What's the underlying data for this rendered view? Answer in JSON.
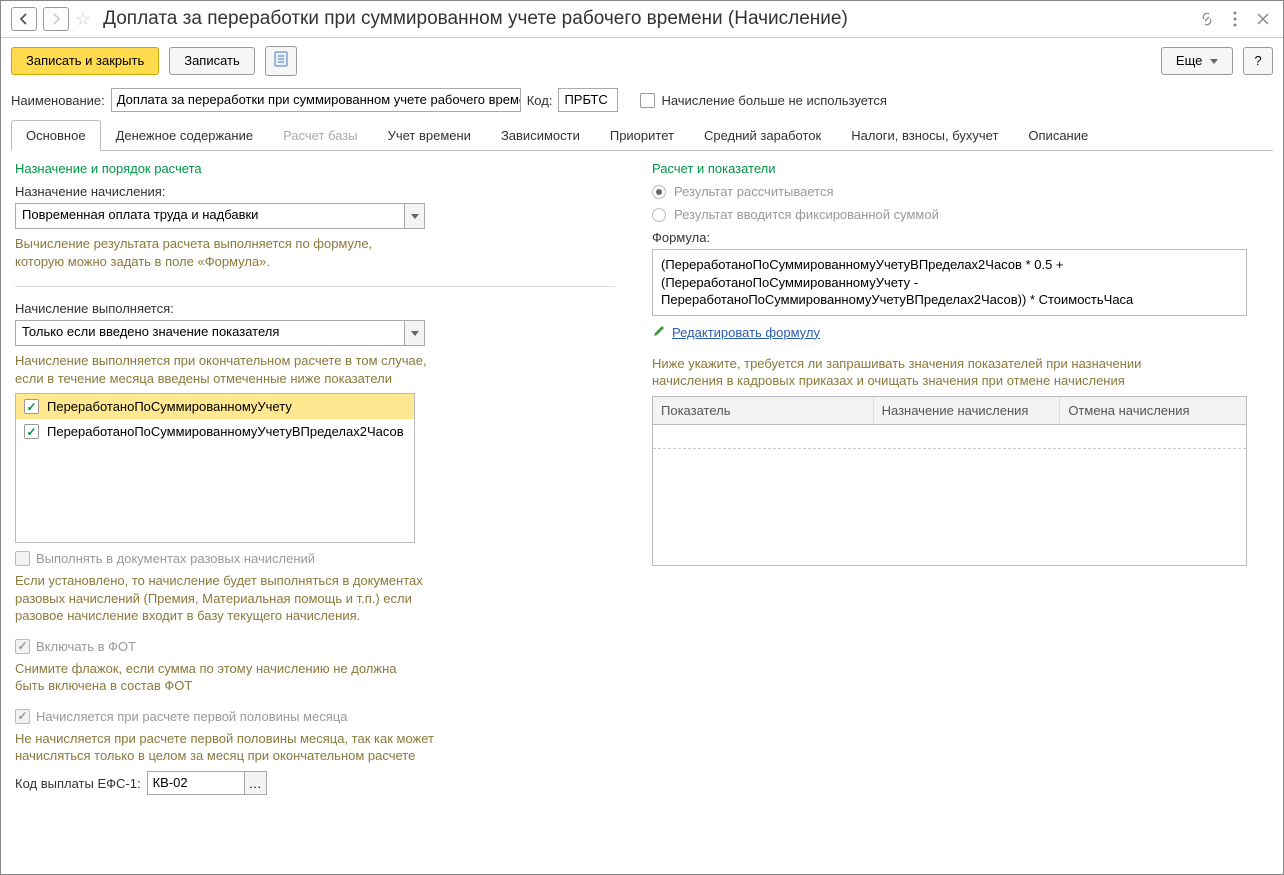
{
  "titlebar": {
    "title": "Доплата за переработки при суммированном учете рабочего времени (Начисление)"
  },
  "toolbar": {
    "save_close": "Записать и закрыть",
    "save": "Записать",
    "more": "Еще",
    "help": "?"
  },
  "header_fields": {
    "name_label": "Наименование:",
    "name_value": "Доплата за переработки при суммированном учете рабочего време",
    "code_label": "Код:",
    "code_value": "ПРБТС",
    "not_used_label": "Начисление больше не используется"
  },
  "tabs": [
    {
      "label": "Основное",
      "active": true
    },
    {
      "label": "Денежное содержание"
    },
    {
      "label": "Расчет базы",
      "disabled": true
    },
    {
      "label": "Учет времени"
    },
    {
      "label": "Зависимости"
    },
    {
      "label": "Приоритет"
    },
    {
      "label": "Средний заработок"
    },
    {
      "label": "Налоги, взносы, бухучет"
    },
    {
      "label": "Описание"
    }
  ],
  "left": {
    "section1_title": "Назначение и порядок расчета",
    "purpose_label": "Назначение начисления:",
    "purpose_value": "Повременная оплата труда и надбавки",
    "purpose_hint": "Вычисление результата расчета выполняется по формуле, которую можно задать в поле «Формула».",
    "exec_label": "Начисление выполняется:",
    "exec_value": "Только если введено значение показателя",
    "exec_hint": "Начисление выполняется при окончательном расчете в том случае, если в течение месяца введены отмеченные ниже показатели",
    "indicators": [
      {
        "label": "ПереработаноПоСуммированномуУчету",
        "checked": true,
        "highlight": true
      },
      {
        "label": "ПереработаноПоСуммированномуУчетуВПределах2Часов",
        "checked": true
      }
    ],
    "oneoff_label": "Выполнять в документах разовых начислений",
    "oneoff_hint": "Если установлено, то начисление будет выполняться в документах разовых начислений (Премия, Материальная помощь и т.п.) если разовое начисление входит в базу текущего начисления.",
    "fot_label": "Включать в ФОТ",
    "fot_hint": "Снимите флажок, если сумма по этому начислению не должна быть включена в состав ФОТ",
    "firsthalf_label": "Начисляется при расчете первой половины месяца",
    "firsthalf_hint": "Не начисляется при расчете первой половины месяца, так как может начисляться только в целом за месяц при окончательном расчете",
    "efs_label": "Код выплаты ЕФС-1:",
    "efs_value": "КВ-02"
  },
  "right": {
    "section_title": "Расчет и показатели",
    "radio1": "Результат рассчитывается",
    "radio2": "Результат вводится фиксированной суммой",
    "formula_label": "Формула:",
    "formula_text": "(ПереработаноПоСуммированномуУчетуВПределах2Часов * 0.5 + (ПереработаноПоСуммированномуУчету - ПереработаноПоСуммированномуУчетуВПределах2Часов)) * СтоимостьЧаса",
    "edit_link": "Редактировать формулу",
    "grid_hint": "Ниже укажите, требуется ли запрашивать значения показателей при назначении начисления в кадровых приказах и очищать значения при отмене начисления",
    "grid_cols": {
      "c1": "Показатель",
      "c2": "Назначение начисления",
      "c3": "Отмена начисления"
    }
  }
}
